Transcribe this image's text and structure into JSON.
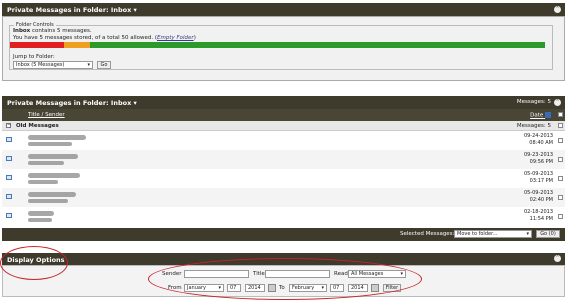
{
  "folder_bar": {
    "title": "Private Messages in Folder: Inbox ▾",
    "collapse_icon": "collapse-icon"
  },
  "folder_controls": {
    "legend": "Folder Controls",
    "inbox_label": "Inbox",
    "contains_text": " contains 5 messages.",
    "stored_text": "You have 5 messages stored, of a total 50 allowed. (",
    "empty_link": "Empty Folder",
    "close_paren": ")",
    "quota": {
      "used": 5,
      "total": 50,
      "segments": [
        {
          "color": "#e02020",
          "fraction": 0.1
        },
        {
          "color": "#f0a020",
          "fraction": 0.05
        },
        {
          "color": "#2a9a2a",
          "fraction": 0.85
        }
      ]
    },
    "jump_label": "Jump to Folder:",
    "jump_value": "Inbox (5 Messages)",
    "go_label": "Go"
  },
  "messages_bar": {
    "title": "Private Messages in Folder: Inbox ▾",
    "count_label": "Messages: 5"
  },
  "columns": {
    "title_sender": "Title / Sender",
    "date": "Date"
  },
  "group": {
    "label": "Old Messages",
    "count": "Messages: 5"
  },
  "messages": [
    {
      "date": "09-24-2013",
      "time": "08:40 AM"
    },
    {
      "date": "09-23-2013",
      "time": "09:56 PM"
    },
    {
      "date": "05-09-2013",
      "time": "03:17 PM"
    },
    {
      "date": "05-09-2013",
      "time": "02:40 PM"
    },
    {
      "date": "02-18-2013",
      "time": "11:54 PM"
    }
  ],
  "footer": {
    "selected_label": "Selected Messages:",
    "action_value": "Move to folder...",
    "go_label": "Go (0)"
  },
  "display_options": {
    "title": "Display Options",
    "sender_label": "Sender",
    "title_label": "Title",
    "read_label": "Read",
    "read_value": "All Messages",
    "from_label": "From",
    "from_month": "January",
    "from_day": "07",
    "from_year": "2014",
    "to_label": "To",
    "to_month": "February",
    "to_day": "07",
    "to_year": "2014",
    "filter_label": "Filter"
  }
}
